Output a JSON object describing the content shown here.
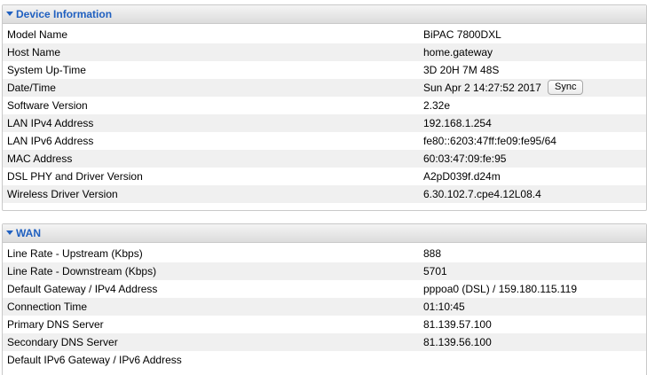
{
  "device_info": {
    "title": "Device Information",
    "rows": [
      {
        "label": "Model Name",
        "value": "BiPAC 7800DXL"
      },
      {
        "label": "Host Name",
        "value": "home.gateway"
      },
      {
        "label": "System Up-Time",
        "value": "3D 20H 7M 48S"
      },
      {
        "label": "Date/Time",
        "value": "Sun Apr 2 14:27:52 2017",
        "button": "Sync"
      },
      {
        "label": "Software Version",
        "value": "2.32e"
      },
      {
        "label": "LAN IPv4 Address",
        "value": "192.168.1.254"
      },
      {
        "label": "LAN IPv6 Address",
        "value": "fe80::6203:47ff:fe09:fe95/64"
      },
      {
        "label": "MAC Address",
        "value": "60:03:47:09:fe:95"
      },
      {
        "label": "DSL PHY and Driver Version",
        "value": "A2pD039f.d24m"
      },
      {
        "label": "Wireless Driver Version",
        "value": "6.30.102.7.cpe4.12L08.4"
      }
    ]
  },
  "wan": {
    "title": "WAN",
    "rows": [
      {
        "label": "Line Rate - Upstream (Kbps)",
        "value": "888"
      },
      {
        "label": "Line Rate - Downstream (Kbps)",
        "value": "5701"
      },
      {
        "label": "Default Gateway / IPv4 Address",
        "value": "pppoa0 (DSL) / 159.180.115.119"
      },
      {
        "label": "Connection Time",
        "value": "01:10:45"
      },
      {
        "label": "Primary DNS Server",
        "value": "81.139.57.100"
      },
      {
        "label": "Secondary DNS Server",
        "value": "81.139.56.100"
      },
      {
        "label": "Default IPv6 Gateway / IPv6 Address",
        "value": ""
      }
    ]
  },
  "colors": {
    "header_text": "#2060c0",
    "row_alt": "#f0f0f0",
    "border": "#c9c9c9"
  },
  "icons": {
    "section_toggle": "triangle-down-icon"
  }
}
